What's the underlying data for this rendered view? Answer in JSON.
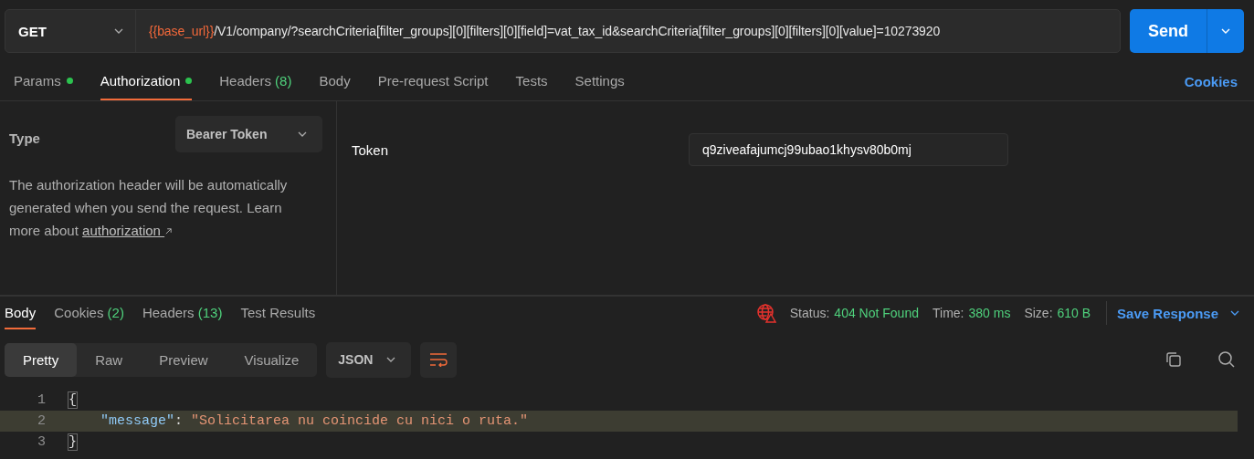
{
  "request": {
    "method": "GET",
    "url_variable": "{{base_url}}",
    "url_path": "/V1/company/?searchCriteria[filter_groups][0][filters][0][field]=vat_tax_id&searchCriteria[filter_groups][0][filters][0][value]=10273920",
    "send": "Send"
  },
  "request_tabs": [
    {
      "label": "Params",
      "dot": true,
      "selected": false
    },
    {
      "label": "Authorization",
      "dot": true,
      "selected": true
    },
    {
      "label": "Headers",
      "count": "(8)",
      "dot": false,
      "selected": false
    },
    {
      "label": "Body",
      "dot": false,
      "selected": false
    },
    {
      "label": "Pre-request Script",
      "dot": false,
      "selected": false
    },
    {
      "label": "Tests",
      "dot": false,
      "selected": false
    },
    {
      "label": "Settings",
      "dot": false,
      "selected": false
    }
  ],
  "cookies_link": "Cookies",
  "auth": {
    "type_label": "Type",
    "type_value": "Bearer Token",
    "description": "The authorization header will be automatically generated when you send the request. Learn more about ",
    "link": "authorization",
    "token_label": "Token",
    "token_value": "q9ziveafajumcj99ubao1khysv80b0mj"
  },
  "response_tabs": [
    {
      "label": "Body",
      "selected": true
    },
    {
      "label": "Cookies",
      "count": "(2)",
      "selected": false
    },
    {
      "label": "Headers",
      "count": "(13)",
      "selected": false
    },
    {
      "label": "Test Results",
      "selected": false
    }
  ],
  "status": {
    "status_label": "Status:",
    "status_value": "404 Not Found",
    "time_label": "Time:",
    "time_value": "380 ms",
    "size_label": "Size:",
    "size_value": "610 B",
    "save_response": "Save Response"
  },
  "view_modes": [
    {
      "label": "Pretty",
      "selected": true
    },
    {
      "label": "Raw",
      "selected": false
    },
    {
      "label": "Preview",
      "selected": false
    },
    {
      "label": "Visualize",
      "selected": false
    }
  ],
  "format": "JSON",
  "code_lines": [
    {
      "number": "1",
      "highlighted": false,
      "parts": [
        {
          "kind": "brace",
          "text": "{"
        }
      ]
    },
    {
      "number": "2",
      "highlighted": true,
      "parts": [
        {
          "kind": "key",
          "text": "\"message\""
        },
        {
          "kind": "punct",
          "text": ": "
        },
        {
          "kind": "string",
          "text": "\"Solicitarea nu coincide cu nici o ruta.\""
        }
      ]
    },
    {
      "number": "3",
      "highlighted": false,
      "parts": [
        {
          "kind": "brace",
          "text": "}"
        }
      ]
    }
  ]
}
